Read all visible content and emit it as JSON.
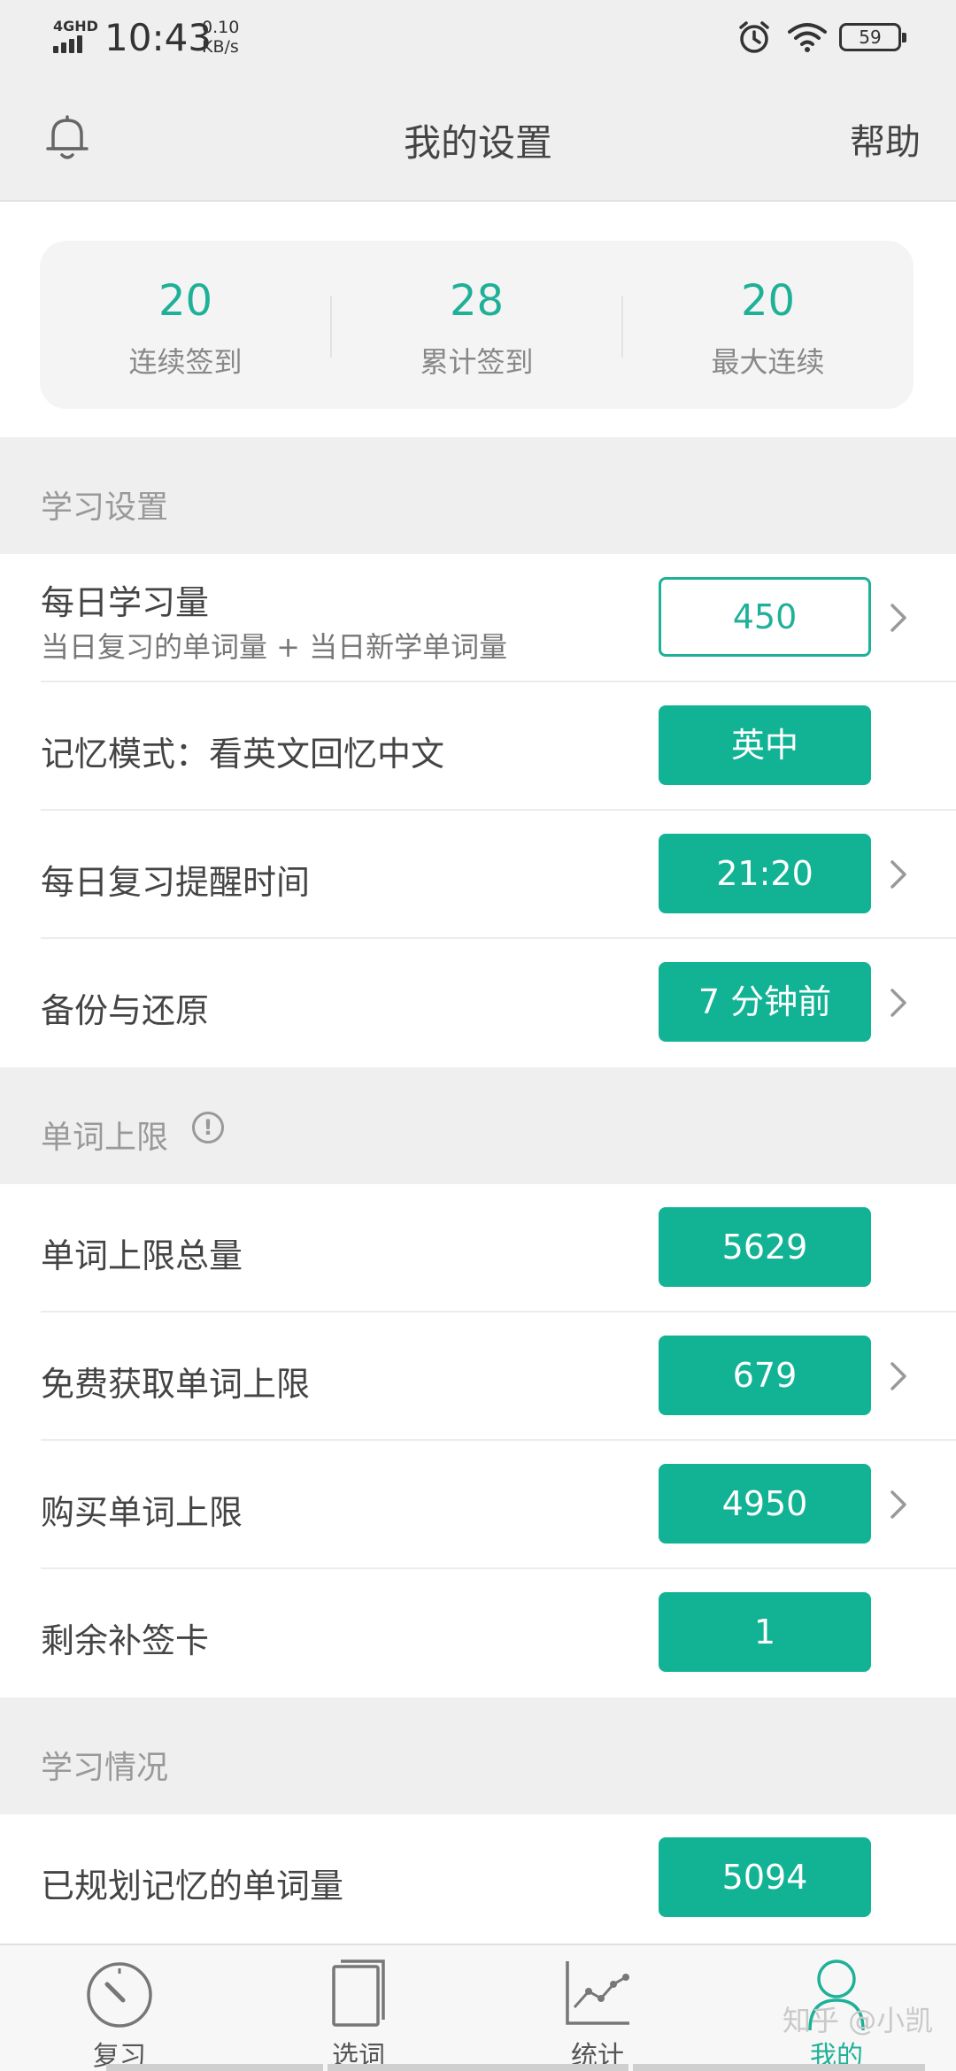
{
  "status_bar": {
    "network": "4GHD",
    "time": "10:43",
    "speed_value": "0.10",
    "speed_unit": "KB/s",
    "battery": "59",
    "icons": [
      "signal-icon",
      "alarm-icon",
      "wifi-icon",
      "battery-icon"
    ]
  },
  "header": {
    "title": "我的设置",
    "help": "帮助",
    "left_icon": "bell-icon"
  },
  "stats": [
    {
      "value": "20",
      "label": "连续签到"
    },
    {
      "value": "28",
      "label": "累计签到"
    },
    {
      "value": "20",
      "label": "最大连续"
    }
  ],
  "sections": {
    "study": {
      "title": "学习设置",
      "rows": [
        {
          "label": "每日学习量",
          "sub": "当日复习的单词量 + 当日新学单词量",
          "value": "450"
        },
        {
          "label": "记忆模式：看英文回忆中文",
          "value": "英中"
        },
        {
          "label": "每日复习提醒时间",
          "value": "21:20"
        },
        {
          "label": "备份与还原",
          "value": "7 分钟前"
        }
      ]
    },
    "limit": {
      "title": "单词上限",
      "info_icon": "!",
      "rows": [
        {
          "label": "单词上限总量",
          "value": "5629"
        },
        {
          "label": "免费获取单词上限",
          "value": "679"
        },
        {
          "label": "购买单词上限",
          "value": "4950"
        },
        {
          "label": "剩余补签卡",
          "value": "1"
        }
      ]
    },
    "progress": {
      "title": "学习情况",
      "rows": [
        {
          "label": "已规划记忆的单词量",
          "value": "5094"
        }
      ]
    }
  },
  "tabs": [
    {
      "label": "复习",
      "icon": "gauge-icon"
    },
    {
      "label": "选词",
      "icon": "book-icon"
    },
    {
      "label": "统计",
      "icon": "chart-icon"
    },
    {
      "label": "我的",
      "icon": "user-icon",
      "active": true
    }
  ],
  "watermark": "知乎 @小凯",
  "colors": {
    "accent": "#12b394",
    "background": "#efefef",
    "text": "#444444",
    "muted": "#999999"
  }
}
